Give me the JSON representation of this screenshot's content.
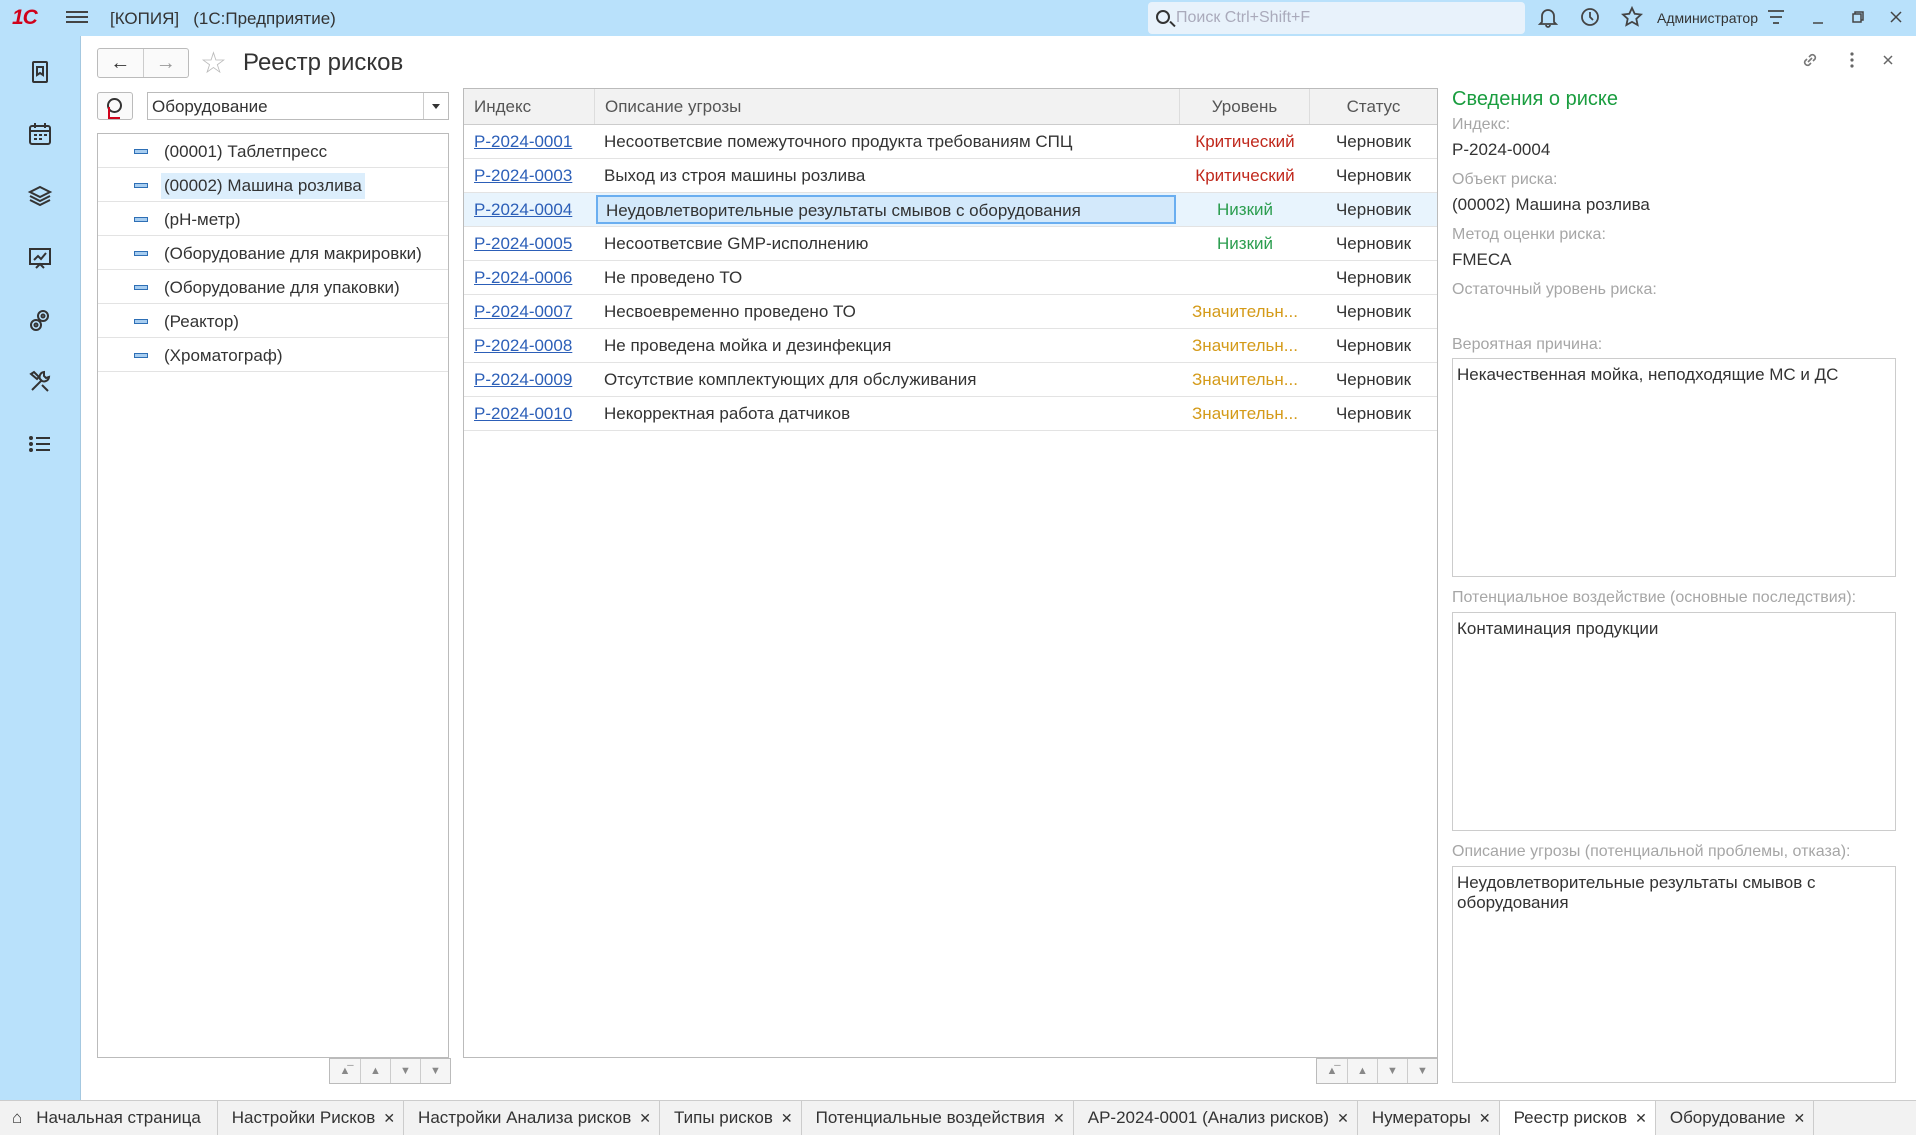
{
  "titlebar": {
    "logo": "1С",
    "title": "[КОПИЯ]   (1С:Предприятие)",
    "search_placeholder": "Поиск Ctrl+Shift+F",
    "user": "Администратор"
  },
  "form": {
    "title": "Реестр рисков",
    "filter_value": "Оборудование"
  },
  "tree": {
    "items": [
      {
        "label": "(00001) Таблетпресс",
        "selected": false
      },
      {
        "label": "(00002) Машина розлива",
        "selected": true
      },
      {
        "label": "(pH-метр)",
        "selected": false
      },
      {
        "label": "(Оборудование для макрировки)",
        "selected": false
      },
      {
        "label": "(Оборудование для упаковки)",
        "selected": false
      },
      {
        "label": "(Реактор)",
        "selected": false
      },
      {
        "label": "(Хроматограф)",
        "selected": false
      }
    ]
  },
  "grid": {
    "columns": [
      "Индекс",
      "Описание угрозы",
      "Уровень",
      "Статус"
    ],
    "rows": [
      {
        "index": "Р-2024-0001",
        "desc": "Несоответсвие помежуточного продукта требованиям СПЦ",
        "level": "Критический",
        "level_type": "crit",
        "status": "Черновик"
      },
      {
        "index": "Р-2024-0003",
        "desc": "Выход из строя машины розлива",
        "level": "Критический",
        "level_type": "crit",
        "status": "Черновик"
      },
      {
        "index": "Р-2024-0004",
        "desc": "Неудовлетворительные результаты смывов с оборудования",
        "level": "Низкий",
        "level_type": "low",
        "status": "Черновик",
        "selected": true
      },
      {
        "index": "Р-2024-0005",
        "desc": "Несоответсвие GMP-исполнению",
        "level": "Низкий",
        "level_type": "low",
        "status": "Черновик"
      },
      {
        "index": "Р-2024-0006",
        "desc": "Не проведено ТО",
        "level": "",
        "level_type": "",
        "status": "Черновик"
      },
      {
        "index": "Р-2024-0007",
        "desc": "Несвоевременно проведено ТО",
        "level": "Значительн...",
        "level_type": "sig",
        "status": "Черновик"
      },
      {
        "index": "Р-2024-0008",
        "desc": "Не проведена мойка и дезинфекция",
        "level": "Значительн...",
        "level_type": "sig",
        "status": "Черновик"
      },
      {
        "index": "Р-2024-0009",
        "desc": "Отсутствие комплектующих для обслуживания",
        "level": "Значительн...",
        "level_type": "sig",
        "status": "Черновик"
      },
      {
        "index": "Р-2024-0010",
        "desc": "Некорректная работа датчиков",
        "level": "Значительн...",
        "level_type": "sig",
        "status": "Черновик"
      }
    ]
  },
  "details": {
    "title": "Сведения о риске",
    "index_label": "Индекс:",
    "index_value": "Р-2024-0004",
    "object_label": "Объект риска:",
    "object_value": "(00002) Машина розлива",
    "method_label": "Метод оценки риска:",
    "method_value": "FMECA",
    "residual_label": "Остаточный уровень риска:",
    "cause_label": "Вероятная причина:",
    "cause_value": "Некачественная мойка, неподходящие МС и ДС",
    "impact_label": "Потенциальное воздействие (основные последствия):",
    "impact_value": "Контаминация продукции",
    "threat_label": "Описание угрозы (потенциальной проблемы, отказа):",
    "threat_value": "Неудовлетворительные результаты смывов с оборудования"
  },
  "tabs": [
    {
      "label": "Начальная страница",
      "home": true
    },
    {
      "label": "Настройки Рисков"
    },
    {
      "label": "Настройки Анализа рисков"
    },
    {
      "label": "Типы рисков"
    },
    {
      "label": "Потенциальные воздействия"
    },
    {
      "label": "АР-2024-0001 (Анализ рисков)"
    },
    {
      "label": "Нумераторы"
    },
    {
      "label": "Реестр рисков",
      "active": true
    },
    {
      "label": "Оборудование"
    }
  ],
  "colors": {
    "titlebar_bg": "#b9e1fb",
    "critical": "#c0281c",
    "low": "#2b9d4f",
    "significant": "#d49a18",
    "details_title": "#1a9d3f",
    "link": "#2c5fb8"
  },
  "icons": {
    "sidebar": [
      "bookmark-icon",
      "calendar-icon",
      "layers-icon",
      "chart-icon",
      "gears-icon",
      "tools-icon",
      "list-icon"
    ],
    "titlebar": [
      "bell-icon",
      "history-icon",
      "star-icon",
      "settings-icon",
      "minimize-icon",
      "restore-icon",
      "close-icon"
    ]
  }
}
